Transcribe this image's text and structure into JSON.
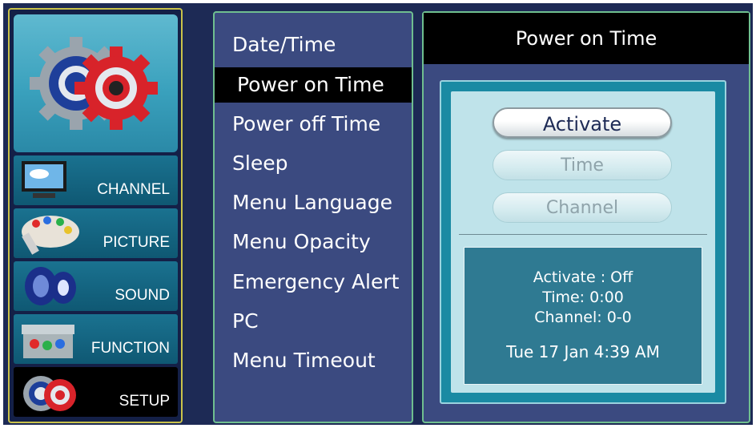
{
  "categories": [
    {
      "label": "CHANNEL",
      "icon": "tv-icon"
    },
    {
      "label": "PICTURE",
      "icon": "palette-icon"
    },
    {
      "label": "SOUND",
      "icon": "speaker-icon"
    },
    {
      "label": "FUNCTION",
      "icon": "toolbox-icon"
    },
    {
      "label": "SETUP",
      "icon": "gears-icon",
      "active": true
    }
  ],
  "menu": {
    "items": [
      {
        "label": "Date/Time"
      },
      {
        "label": "Power on Time",
        "selected": true
      },
      {
        "label": "Power off Time"
      },
      {
        "label": "Sleep"
      },
      {
        "label": "Menu Language"
      },
      {
        "label": "Menu Opacity"
      },
      {
        "label": "Emergency Alert"
      },
      {
        "label": "PC"
      },
      {
        "label": "Menu Timeout"
      }
    ]
  },
  "detail": {
    "title": "Power on Time",
    "buttons": {
      "activate": "Activate",
      "time": "Time",
      "channel": "Channel"
    },
    "info": {
      "activate": "Activate : Off",
      "time": "Time: 0:00",
      "channel": "Channel: 0-0",
      "datetime": "Tue 17 Jan 4:39 AM"
    }
  },
  "colors": {
    "background": "#1d2a55",
    "menu_panel": "#3b4a80",
    "panel_border": "#6fbf8f",
    "left_border": "#c9c24a",
    "teal": "#1a8aa3",
    "selected": "#000000"
  }
}
